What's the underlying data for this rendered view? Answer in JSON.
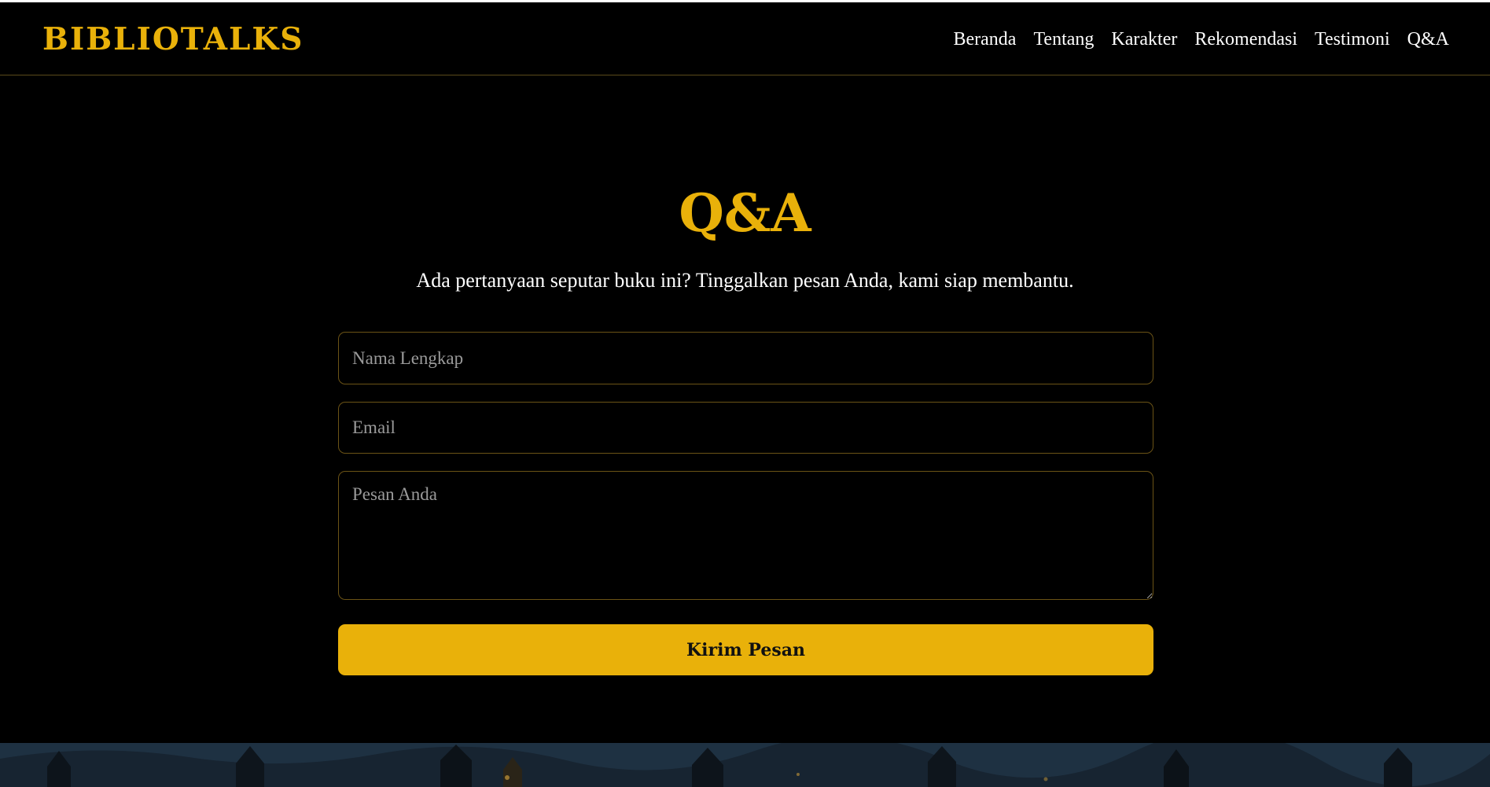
{
  "brand": {
    "name": "BIBLIOTALKS",
    "accent_color": "#e9b10a"
  },
  "nav": {
    "items": [
      {
        "label": "Beranda"
      },
      {
        "label": "Tentang"
      },
      {
        "label": "Karakter"
      },
      {
        "label": "Rekomendasi"
      },
      {
        "label": "Testimoni"
      },
      {
        "label": "Q&A"
      }
    ]
  },
  "qa": {
    "title": "Q&A",
    "subtitle": "Ada pertanyaan seputar buku ini? Tinggalkan pesan Anda, kami siap membantu.",
    "form": {
      "name_placeholder": "Nama Lengkap",
      "email_placeholder": "Email",
      "message_placeholder": "Pesan Anda",
      "submit_label": "Kirim Pesan"
    }
  },
  "colors": {
    "background": "#000000",
    "accent": "#e9b10a",
    "field_border": "#6b5316",
    "text": "#ffffff"
  }
}
